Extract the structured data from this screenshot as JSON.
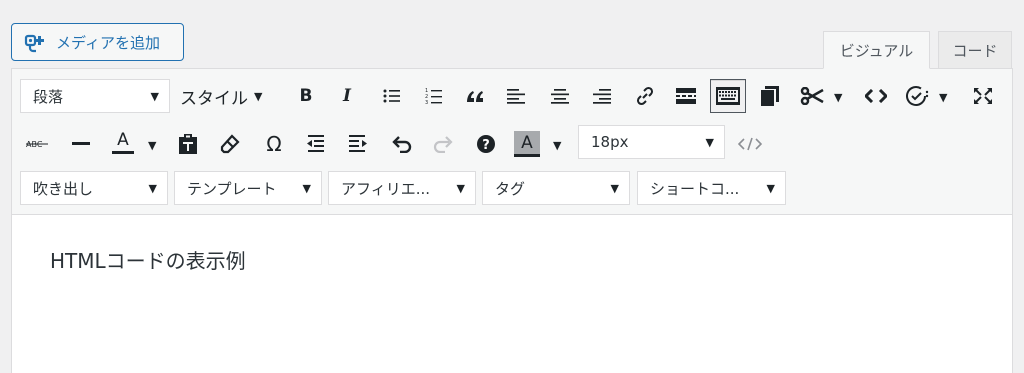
{
  "media_button": {
    "label": "メディアを追加",
    "icon": "media-add-icon"
  },
  "tabs": {
    "visual": "ビジュアル",
    "code": "コード"
  },
  "toolbar": {
    "row1": {
      "format_select": "段落",
      "style_label": "スタイル",
      "bold": "B",
      "italic": "I"
    },
    "row2": {
      "color_letter": "A",
      "highlight_letter": "A",
      "font_size": "18px"
    },
    "row3": {
      "balloon": "吹き出し",
      "template": "テンプレート",
      "affiliate": "アフィリエ...",
      "tag": "タグ",
      "shortcode": "ショートコ..."
    }
  },
  "content": {
    "text": "HTMLコードの表示例"
  },
  "colors": {
    "accent": "#2271b1",
    "toolbar_bg": "#f6f7f7",
    "border": "#dcdcde"
  }
}
